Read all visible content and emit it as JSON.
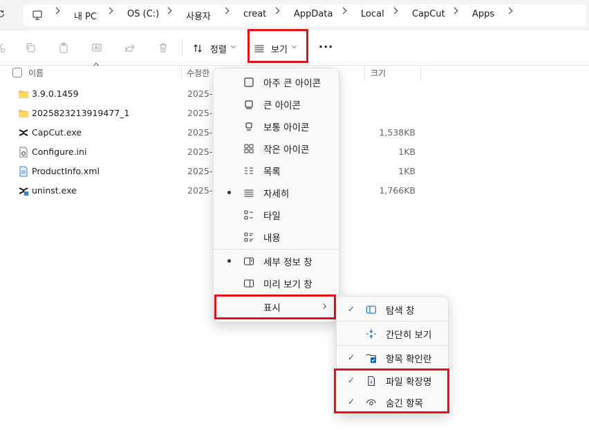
{
  "breadcrumb": [
    "내 PC",
    "OS (C:)",
    "사용자",
    "creat",
    "AppData",
    "Local",
    "CapCut",
    "Apps"
  ],
  "toolbar": {
    "sort_label": "정렬",
    "view_label": "보기",
    "more_label": "..."
  },
  "columns": {
    "name": "이름",
    "modified": "수정한",
    "size": "크기"
  },
  "files": [
    {
      "name": "3.9.0.1459",
      "date": "2025-0",
      "size": "",
      "icon": "folder-icon"
    },
    {
      "name": "2025823213919477_1",
      "date": "2025-0",
      "size": "",
      "icon": "folder-icon"
    },
    {
      "name": "CapCut.exe",
      "date": "2025-0",
      "size": "1,538KB",
      "icon": "capcut-app-icon"
    },
    {
      "name": "Configure.ini",
      "date": "2025-0",
      "size": "1KB",
      "icon": "settings-file-icon"
    },
    {
      "name": "ProductInfo.xml",
      "date": "2025-0",
      "size": "1KB",
      "icon": "xml-file-icon"
    },
    {
      "name": "uninst.exe",
      "date": "2025-0",
      "size": "1,766KB",
      "icon": "capcut-app-icon"
    }
  ],
  "view_menu": {
    "items": [
      {
        "label": "아주 큰 아이콘",
        "icon": "extra-large-icons-icon",
        "selected": false
      },
      {
        "label": "큰 아이콘",
        "icon": "large-icons-icon",
        "selected": false
      },
      {
        "label": "보통 아이콘",
        "icon": "medium-icons-icon",
        "selected": false
      },
      {
        "label": "작은 아이콘",
        "icon": "small-icons-icon",
        "selected": false
      },
      {
        "label": "목록",
        "icon": "list-icon",
        "selected": false
      },
      {
        "label": "자세히",
        "icon": "details-icon",
        "selected": true
      },
      {
        "label": "타일",
        "icon": "tiles-icon",
        "selected": false
      },
      {
        "label": "내용",
        "icon": "content-icon",
        "selected": false
      }
    ],
    "panes": [
      {
        "label": "세부 정보 창",
        "icon": "details-pane-icon",
        "selected": true
      },
      {
        "label": "미리 보기 창",
        "icon": "preview-pane-icon",
        "selected": false
      }
    ],
    "show_label": "표시"
  },
  "show_menu": {
    "items": [
      {
        "label": "탐색 창",
        "icon": "navigation-pane-icon",
        "checked": true
      },
      {
        "label": "간단히 보기",
        "icon": "compact-view-icon",
        "checked": false
      },
      {
        "label": "항목 확인란",
        "icon": "item-checkbox-icon",
        "checked": true
      },
      {
        "label": "파일 확장명",
        "icon": "file-extension-icon",
        "checked": true
      },
      {
        "label": "숨긴 항목",
        "icon": "hidden-items-icon",
        "checked": true
      }
    ]
  },
  "colors": {
    "highlight": "#e3111b",
    "folder": "#f5c04a"
  }
}
